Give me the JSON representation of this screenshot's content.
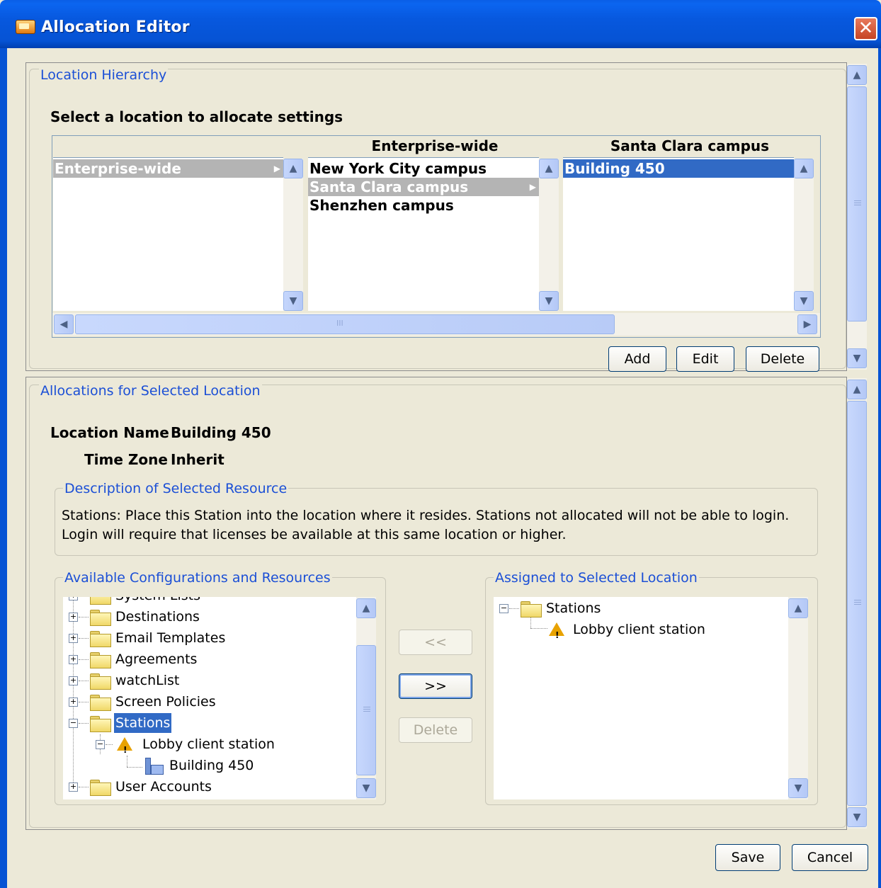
{
  "window": {
    "title": "Allocation Editor",
    "close_glyph": "✕"
  },
  "hierarchy": {
    "group_label": "Location Hierarchy",
    "heading": "Select a location to allocate settings",
    "columns": [
      {
        "header": "",
        "items": [
          "Enterprise-wide"
        ]
      },
      {
        "header": "Enterprise-wide",
        "items": [
          "New York City campus",
          "Santa Clara campus",
          "Shenzhen campus"
        ]
      },
      {
        "header": "Santa Clara campus",
        "items": [
          "Building 450"
        ]
      }
    ],
    "hscroll_grip": "III",
    "buttons": {
      "add": "Add",
      "edit": "Edit",
      "delete": "Delete"
    }
  },
  "allocations": {
    "group_label": "Allocations for Selected Location",
    "location_name_label": "Location Name",
    "location_name_value": "Building 450",
    "time_zone_label": "Time Zone",
    "time_zone_value": "Inherit",
    "description": {
      "group_label": "Description of Selected Resource",
      "text": "Stations: Place this Station into the location where it resides.  Stations not allocated will not be able to login.  Login will require that licenses be available at this same location or higher."
    },
    "available": {
      "group_label": "Available Configurations and Resources",
      "partial_item": "System Lists",
      "items": [
        "Destinations",
        "Email Templates",
        "Agreements",
        "watchList",
        "Screen Policies",
        "Stations",
        "Lobby client station",
        "Building 450",
        "User Accounts"
      ]
    },
    "transfer_buttons": {
      "left": "<<",
      "right": ">>",
      "delete": "Delete"
    },
    "assigned": {
      "group_label": "Assigned to Selected Location",
      "items": [
        "Stations",
        "Lobby client station"
      ]
    }
  },
  "footer": {
    "save": "Save",
    "cancel": "Cancel"
  },
  "colors": {
    "title_bar": "#0653d4",
    "selection": "#316ac5",
    "group_label": "#1b4fd6"
  }
}
